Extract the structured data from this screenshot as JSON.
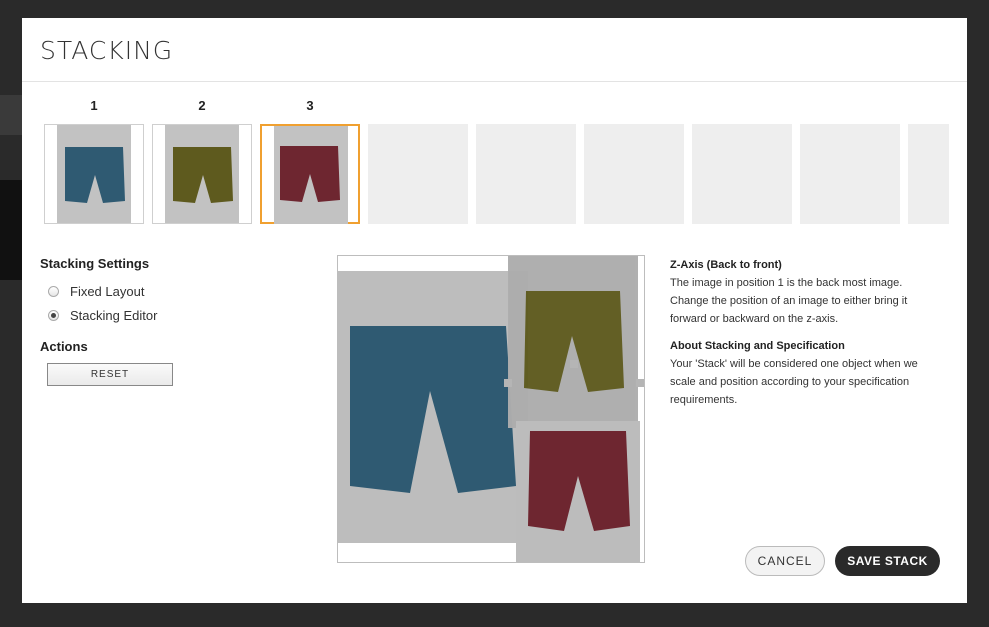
{
  "modal": {
    "title": "STACKING"
  },
  "slots": [
    {
      "number": "1",
      "item_color": "#2f5a72"
    },
    {
      "number": "2",
      "item_color": "#5e5a1e"
    },
    {
      "number": "3",
      "item_color": "#6e2630"
    }
  ],
  "settings": {
    "title": "Stacking Settings",
    "options": [
      {
        "label": "Fixed Layout",
        "checked": false
      },
      {
        "label": "Stacking Editor",
        "checked": true
      }
    ]
  },
  "actions": {
    "title": "Actions",
    "reset_label": "RESET"
  },
  "info": {
    "z_axis_title": "Z-Axis (Back to front)",
    "z_axis_text": "The image in position 1 is the back most image. Change the position of an image to either bring it forward or backward on the z-axis.",
    "about_title": "About Stacking and Specification",
    "about_text": "Your 'Stack' will be considered one object when we scale and position according to your specification requirements."
  },
  "footer": {
    "cancel_label": "CANCEL",
    "save_label": "SAVE STACK"
  }
}
